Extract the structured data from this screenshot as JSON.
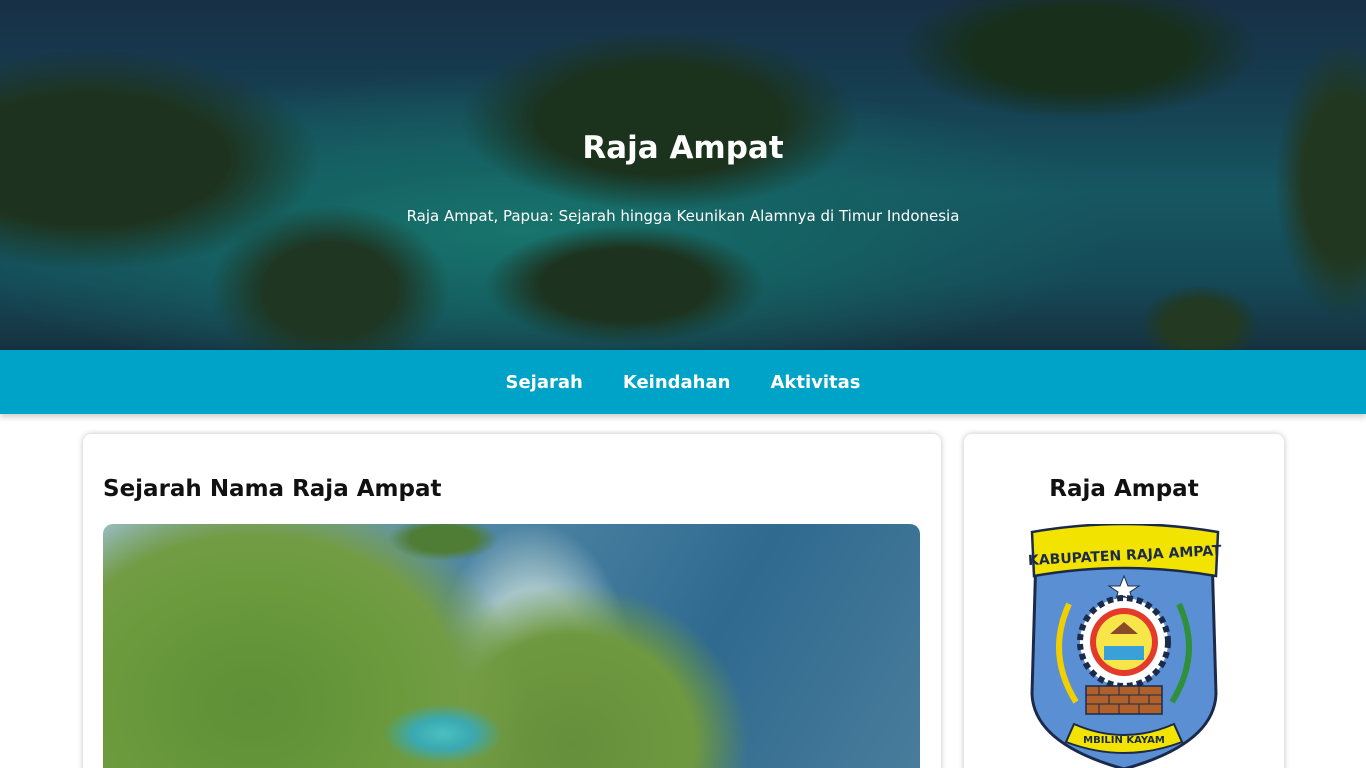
{
  "hero": {
    "title": "Raja Ampat",
    "subtitle": "Raja Ampat, Papua: Sejarah hingga Keunikan Alamnya di Timur Indonesia"
  },
  "nav": {
    "items": [
      {
        "label": "Sejarah"
      },
      {
        "label": "Keindahan"
      },
      {
        "label": "Aktivitas"
      }
    ],
    "background_color": "#00a3c8"
  },
  "article": {
    "title": "Sejarah Nama Raja Ampat"
  },
  "sidebar": {
    "title": "Raja Ampat",
    "logo": {
      "top_text": "KABUPATEN RAJA AMPAT",
      "bottom_text": "MBILIN KAYAM"
    }
  }
}
